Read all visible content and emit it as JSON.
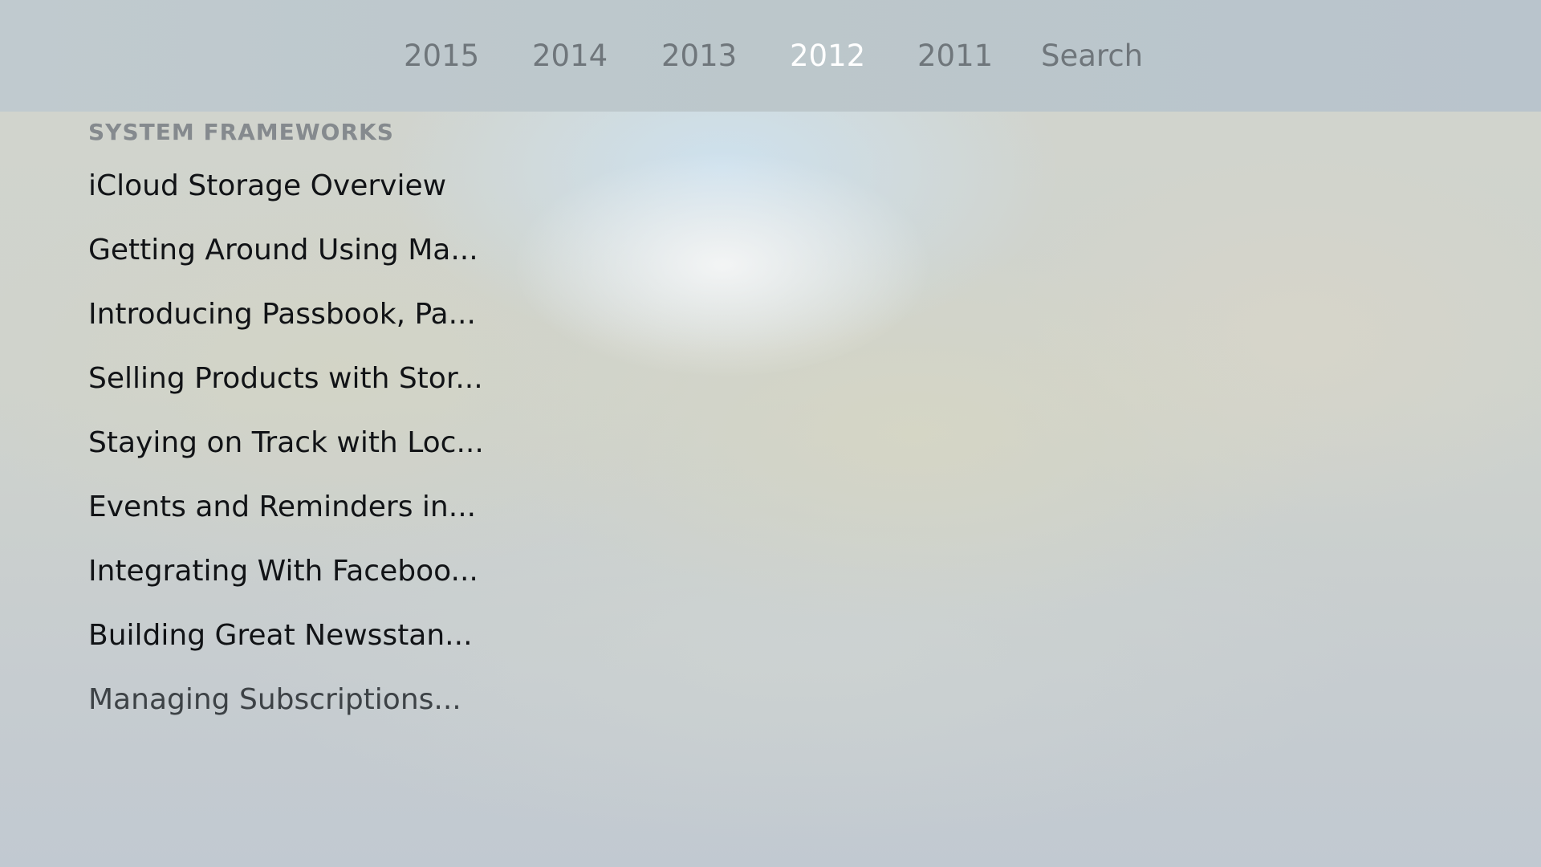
{
  "nav": {
    "tabs": [
      {
        "label": "2015"
      },
      {
        "label": "2014"
      },
      {
        "label": "2013"
      },
      {
        "label": "2012",
        "selected": true
      },
      {
        "label": "2011"
      },
      {
        "label": "Search"
      }
    ]
  },
  "section": {
    "title": "SYSTEM FRAMEWORKS",
    "items": [
      {
        "label": "iCloud Storage Overview"
      },
      {
        "label": "Getting Around Using Ma..."
      },
      {
        "label": "Introducing Passbook, Pa..."
      },
      {
        "label": "Selling Products with Stor..."
      },
      {
        "label": "Staying on Track with Loc..."
      },
      {
        "label": "Events and Reminders in..."
      },
      {
        "label": "Integrating With Faceboo..."
      },
      {
        "label": "Building Great Newsstan..."
      },
      {
        "label": "Managing Subscriptions..."
      }
    ]
  },
  "colors": {
    "selected_tab": "#ffffff",
    "tab_text": "#6f767b",
    "section_title": "#858a8e",
    "item_text": "#111316"
  }
}
